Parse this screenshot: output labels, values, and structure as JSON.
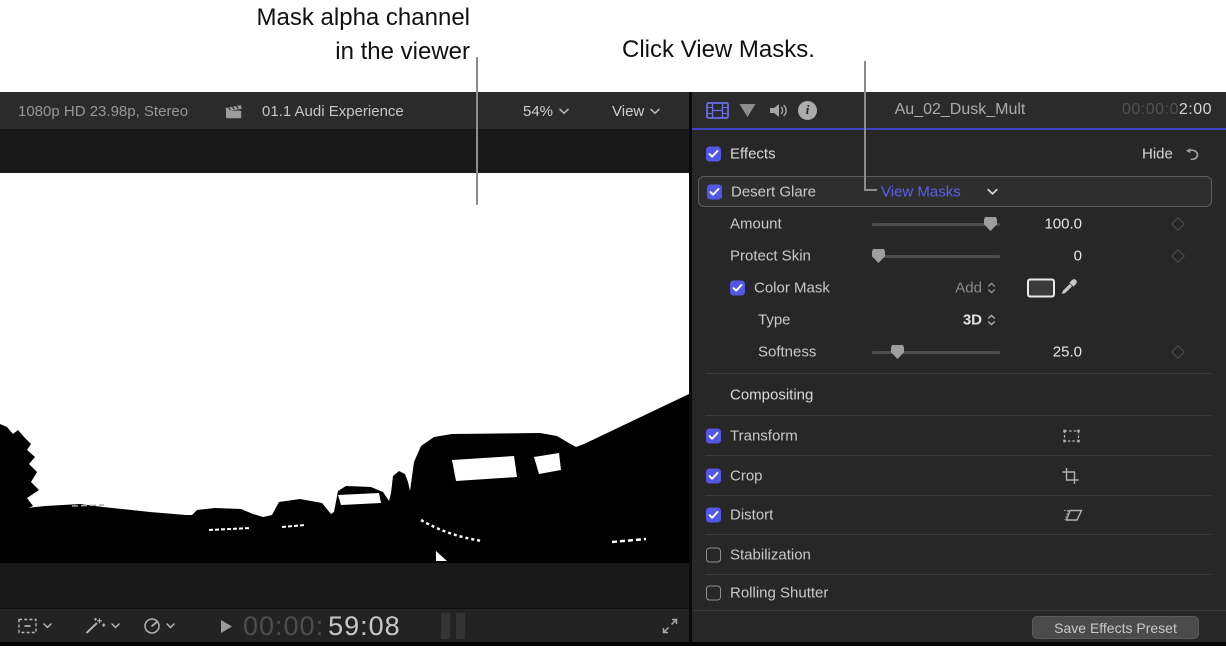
{
  "annotations": {
    "viewer_line1": "Mask alpha channel",
    "viewer_line2": "in the viewer",
    "click_view_masks": "Click View Masks."
  },
  "viewer": {
    "format_info": "1080p HD 23.98p, Stereo",
    "project_title": "01.1 Audi Experience",
    "zoom_level": "54%",
    "view_label": "View",
    "timecode_dim": "00:00:",
    "timecode_bright": "59:08"
  },
  "inspector": {
    "clip_title": "Au_02_Dusk_Mult",
    "timecode_dim": "00:00:0",
    "timecode_bright": "2:00",
    "effects": {
      "label": "Effects",
      "hide_label": "Hide"
    },
    "desert_glare": {
      "label": "Desert Glare",
      "view_masks_label": "View Masks"
    },
    "amount": {
      "label": "Amount",
      "value": "100.0"
    },
    "protect_skin": {
      "label": "Protect Skin",
      "value": "0"
    },
    "color_mask": {
      "label": "Color Mask",
      "blend_mode": "Add"
    },
    "type": {
      "label": "Type",
      "value": "3D"
    },
    "softness": {
      "label": "Softness",
      "value": "25.0"
    },
    "compositing": {
      "label": "Compositing"
    },
    "transform": {
      "label": "Transform"
    },
    "crop": {
      "label": "Crop"
    },
    "distort": {
      "label": "Distort"
    },
    "stabilization": {
      "label": "Stabilization"
    },
    "rolling_shutter": {
      "label": "Rolling Shutter"
    },
    "save_preset_label": "Save Effects Preset"
  },
  "colors": {
    "checkbox_accent": "#5357e6",
    "link_blue": "#5a5de9",
    "video_tab_active": "#6e6eea",
    "inspector_underline": "#4141c6"
  },
  "icons": {
    "clapper": "clapperboard",
    "video_tab": "film-strip",
    "effects_tab": "triangle-down",
    "audio_tab": "speaker-waves",
    "info_tab": "info-circle",
    "undo": "curved-arrow-left",
    "keyframe": "diamond-outline",
    "chevron": "chevron-down",
    "stepper": "up-down-chevrons",
    "eyedropper": "eyedropper",
    "transform": "dashed-rect-handles",
    "crop": "crop-corners",
    "distort": "parallelogram",
    "overlay_tool": "dashed-rect-minus",
    "enhancements": "magic-wand",
    "retime": "speedometer",
    "play": "play-triangle",
    "expand": "diagonal-arrows"
  }
}
